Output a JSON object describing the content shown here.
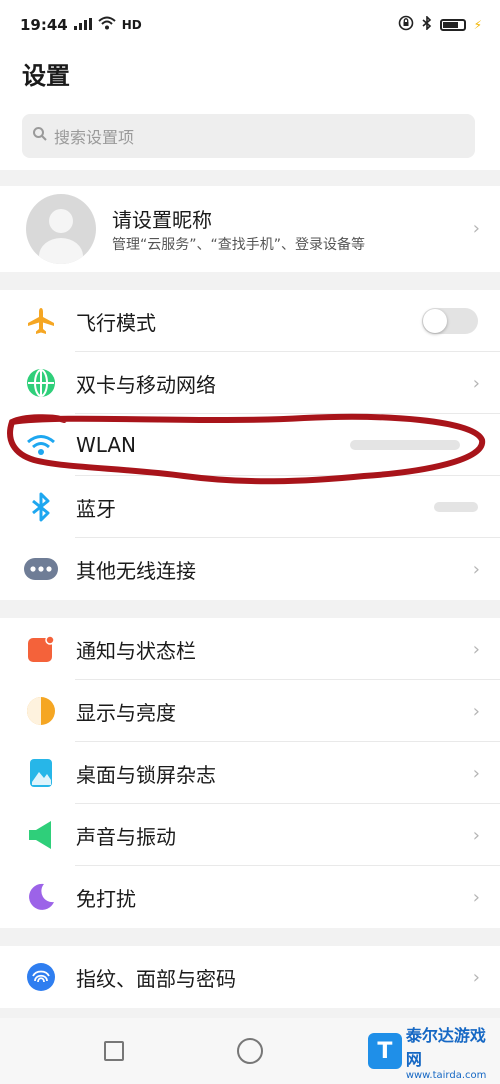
{
  "status_bar": {
    "time": "19:44",
    "network_type": "HD"
  },
  "header": {
    "title": "设置",
    "search_placeholder": "搜索设置项"
  },
  "profile": {
    "name": "请设置昵称",
    "subtitle": "管理“云服务”、“查找手机”、登录设备等"
  },
  "group1": [
    {
      "label": "飞行模式",
      "icon": "airplane-icon",
      "color": "#f5a623",
      "toggle": false
    },
    {
      "label": "双卡与移动网络",
      "icon": "globe-icon",
      "color": "#2fcf7a"
    },
    {
      "label": "WLAN",
      "icon": "wifi-icon",
      "color": "#1ea7f0"
    },
    {
      "label": "蓝牙",
      "icon": "bluetooth-icon",
      "color": "#1ea7f0"
    },
    {
      "label": "其他无线连接",
      "icon": "more-icon",
      "color": "#6f7d96"
    }
  ],
  "group2": [
    {
      "label": "通知与状态栏",
      "icon": "notification-icon",
      "color": "#f4623a"
    },
    {
      "label": "显示与亮度",
      "icon": "brightness-icon",
      "color": "#f5a623"
    },
    {
      "label": "桌面与锁屏杂志",
      "icon": "wallpaper-icon",
      "color": "#27b6e8"
    },
    {
      "label": "声音与振动",
      "icon": "sound-icon",
      "color": "#2fcf7a"
    },
    {
      "label": "免打扰",
      "icon": "moon-icon",
      "color": "#9c63e8"
    }
  ],
  "group3": [
    {
      "label": "指纹、面部与密码",
      "icon": "fingerprint-icon",
      "color": "#2f7ef0"
    }
  ],
  "watermark": {
    "line1": "泰尔达游戏网",
    "line2": "www.tairda.com"
  }
}
